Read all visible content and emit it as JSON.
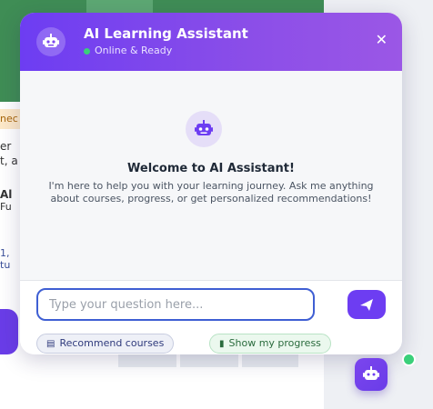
{
  "background": {
    "fragments": [
      "nec",
      "er",
      "t, a",
      "Al",
      "Fu",
      "1,",
      "tu"
    ]
  },
  "chat": {
    "title": "AI Learning Assistant",
    "status": "Online & Ready",
    "close_label": "✕",
    "welcome_title": "Welcome to AI Assistant!",
    "welcome_text": "I'm here to help you with your learning journey. Ask me anything about courses, progress, or get personalized recommendations!",
    "input_placeholder": "Type your question here...",
    "suggestions": [
      {
        "icon": "books-icon",
        "label": "Recommend courses"
      },
      {
        "icon": "chart-icon",
        "label": "Show my progress"
      }
    ]
  },
  "colors": {
    "accent": "#6d3df2",
    "online": "#3ad07a"
  }
}
